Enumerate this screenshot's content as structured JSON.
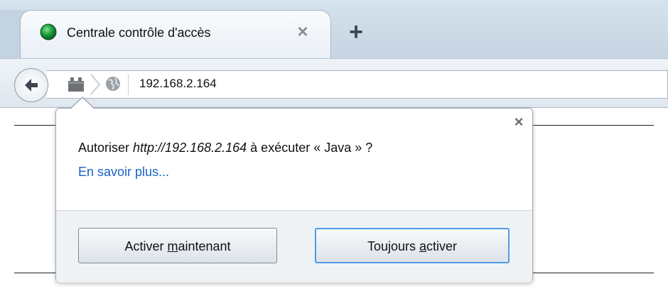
{
  "tab": {
    "title": "Centrale contrôle d'accès",
    "close_glyph": "×",
    "new_tab_glyph": "+",
    "favicon": "green-circle-icon"
  },
  "navbar": {
    "back": "back-arrow-icon",
    "plugin": "plugin-icon",
    "identity": "globe-icon",
    "url": "192.168.2.164"
  },
  "popup": {
    "message_before": "Autoriser ",
    "message_origin": "http://192.168.2.164",
    "message_after": " à exécuter « Java » ?",
    "learn_more": "En savoir plus...",
    "close_glyph": "×",
    "activate_now": {
      "before": "Activer ",
      "access_key": "m",
      "after": "aintenant"
    },
    "always_activate": {
      "before": "Toujours ",
      "access_key": "a",
      "after": "ctiver"
    }
  },
  "colors": {
    "link": "#1862c8",
    "focus_ring": "#4f9be3",
    "favicon_green": "#1a9b3a"
  }
}
